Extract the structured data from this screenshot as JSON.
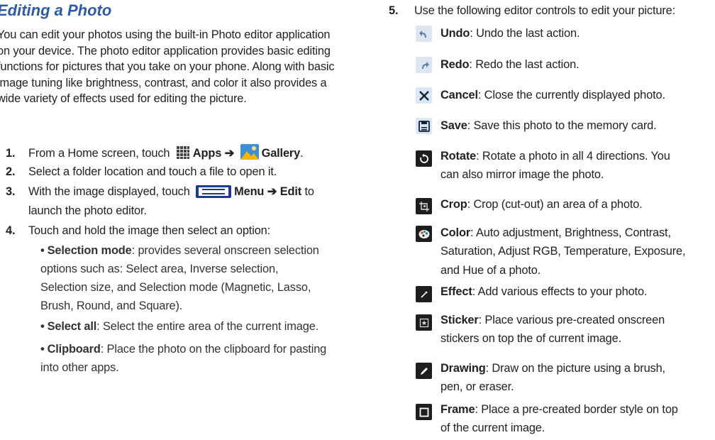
{
  "left": {
    "heading": "Editing a Photo",
    "intro": "You can edit your photos using the built-in Photo editor application on your device. The photo editor application provides basic editing functions for pictures that you take on your phone. Along with basic image tuning like brightness, contrast, and color it also provides a wide variety of effects used for editing the picture.",
    "steps": [
      {
        "num": "1.",
        "pre": "From a Home screen, touch",
        "apps_label": "Apps",
        "arrow": "➔",
        "gallery_label": "Gallery",
        "period": "."
      },
      {
        "num": "2.",
        "text": "Select a folder location and touch a file to open it."
      },
      {
        "num": "3.",
        "pre": "With the image displayed, touch",
        "menu_label": "Menu",
        "arrow": "➔",
        "edit_label": "Edit",
        "post": "to",
        "cont": "launch the photo editor."
      },
      {
        "num": "4.",
        "text": "Touch and hold the image then select an option:"
      }
    ],
    "bullets": [
      {
        "title": "Selection mode",
        "lines": [
          ": provides several onscreen selection",
          "options such as: Select area, Inverse selection,",
          "Selection size, and Selection mode (Magnetic, Lasso,",
          "Brush, Round, and Square)."
        ]
      },
      {
        "title": "Select all",
        "lines": [
          ": Select the entire area of the current image."
        ]
      },
      {
        "title": "Clipboard",
        "lines": [
          ": Place the photo on the clipboard for pasting",
          "into other apps."
        ]
      }
    ]
  },
  "right": {
    "step5": {
      "num": "5.",
      "text": "Use the following editor controls to edit your picture:"
    },
    "controls": [
      {
        "icon": "undo-icon",
        "title": "Undo",
        "lines": [
          ": Undo the last action."
        ]
      },
      {
        "icon": "redo-icon",
        "title": "Redo",
        "lines": [
          ": Redo the last action."
        ]
      },
      {
        "icon": "cancel-icon",
        "title": "Cancel",
        "lines": [
          ": Close the currently displayed photo."
        ]
      },
      {
        "icon": "save-icon",
        "title": "Save",
        "lines": [
          ": Save this photo to the memory card."
        ]
      },
      {
        "icon": "rotate-icon",
        "title": "Rotate",
        "lines": [
          ": Rotate a photo in all 4 directions. You",
          "can also mirror image the photo."
        ]
      },
      {
        "icon": "crop-icon",
        "title": "Crop",
        "lines": [
          ": Crop (cut-out) an area of a photo."
        ]
      },
      {
        "icon": "color-palette-icon",
        "title": "Color",
        "lines": [
          ": Auto adjustment, Brightness, Contrast,",
          "Saturation, Adjust RGB, Temperature, Exposure,",
          "and Hue of a photo."
        ]
      },
      {
        "icon": "effect-wand-icon",
        "title": "Effect",
        "lines": [
          ": Add various effects to your photo."
        ]
      },
      {
        "icon": "sticker-icon",
        "title": "Sticker",
        "lines": [
          ": Place various pre-created onscreen",
          "stickers on top the of current image."
        ]
      },
      {
        "icon": "drawing-pen-icon",
        "title": "Drawing",
        "lines": [
          ": Draw on the picture using a brush,",
          "pen, or eraser."
        ]
      },
      {
        "icon": "frame-icon",
        "title": "Frame",
        "lines": [
          ": Place a pre-created border style on top",
          "of the current image."
        ]
      }
    ]
  }
}
